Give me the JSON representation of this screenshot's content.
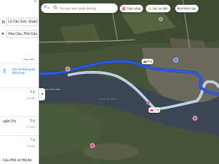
{
  "directions": {
    "origin": "Lộ Cầu Sơn, Quảng Phú",
    "destination": "Hòa Cầu, Phủ Cầu",
    "options_label": "Tùy chọn"
  },
  "send_to_phone": {
    "label": "Gửi chỉ đường tới điện thoại",
    "icon": "send-to-phone-icon"
  },
  "routes": [
    {
      "name": "",
      "time": "6 p",
      "distance": "3,0 km"
    },
    {
      "name": "uyễn Thị",
      "time": "5 p",
      "distance": "2,1 km"
    },
    {
      "name": "",
      "time": "7 p",
      "distance": "2,5 km"
    }
  ],
  "bottom_item": "Cầu Phố cổ Hội An",
  "search": {
    "placeholder": "Tìm dọc theo tuyến đường"
  },
  "chips": [
    {
      "label": "Trạm xăng",
      "icon": "gas-station-icon"
    },
    {
      "label": "Sạc xe điện",
      "icon": "ev-charging-icon"
    },
    {
      "label": "Khách sạn",
      "icon": "hotel-icon"
    }
  ],
  "map": {
    "route_bubbles": [
      {
        "label": "6 p"
      },
      {
        "label": "7 p"
      }
    ],
    "labels": [
      {
        "text": "Cầm Kim mới"
      },
      {
        "text": "sông Thu Bồn"
      }
    ],
    "colors": {
      "primary_route": "#2c5ff0",
      "alt_route": "#a9c1fa",
      "water": "#3b4a56",
      "land": "#44523a",
      "poi": "#d9488b"
    }
  }
}
